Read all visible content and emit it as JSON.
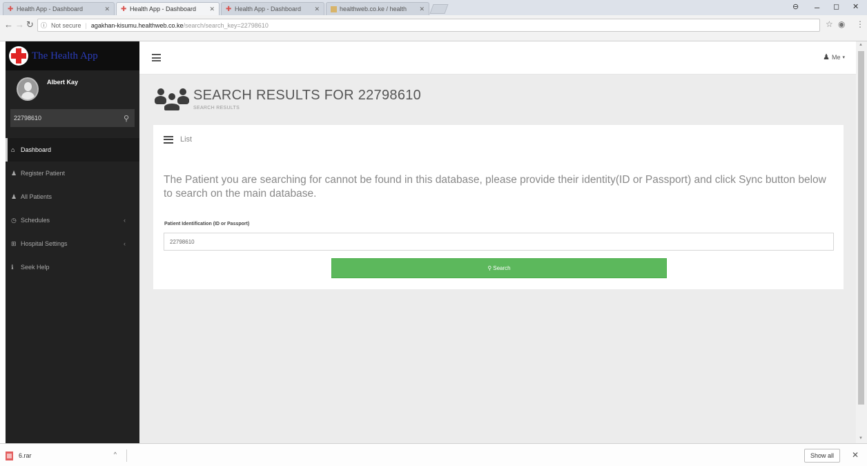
{
  "browser": {
    "tabs": [
      {
        "title": "Health App - Dashboard",
        "active": false,
        "icon": "health-cross-icon"
      },
      {
        "title": "Health App - Dashboard",
        "active": true,
        "icon": "health-cross-icon"
      },
      {
        "title": "Health App - Dashboard",
        "active": false,
        "icon": "health-cross-icon"
      },
      {
        "title": "healthweb.co.ke / health",
        "active": false,
        "icon": "image-icon"
      }
    ],
    "security_label": "Not secure",
    "url_host": "agakhan-kisumu.healthweb.co.ke",
    "url_path": "/search/search_key=22798610"
  },
  "sidebar": {
    "brand_name": "The Health App",
    "user_name": "Albert Kay",
    "search_value": "22798610",
    "menu": [
      {
        "label": "Dashboard",
        "icon": "home-icon",
        "glyph": "⌂",
        "active": true,
        "has_submenu": false
      },
      {
        "label": "Register Patient",
        "icon": "user-icon",
        "glyph": "♟",
        "active": false,
        "has_submenu": false
      },
      {
        "label": "All Patients",
        "icon": "users-icon",
        "glyph": "♟",
        "active": false,
        "has_submenu": false
      },
      {
        "label": "Schedules",
        "icon": "clock-icon",
        "glyph": "◷",
        "active": false,
        "has_submenu": true
      },
      {
        "label": "Hospital Settings",
        "icon": "hospital-icon",
        "glyph": "⊞",
        "active": false,
        "has_submenu": true
      },
      {
        "label": "Seek Help",
        "icon": "info-icon",
        "glyph": "ℹ",
        "active": false,
        "has_submenu": false
      }
    ]
  },
  "topbar": {
    "user_menu_label": "Me"
  },
  "page": {
    "title": "SEARCH RESULTS FOR 22798610",
    "subtitle": "SEARCH RESULTS",
    "panel_title": "List",
    "message": "The Patient you are searching for cannot be found in this database, please provide their identity(ID or Passport) and click Sync button below to search on the main database.",
    "field_label": "Patient Identification (ID or Passport)",
    "field_value": "22798610",
    "search_button_label": "Search"
  },
  "downloads": {
    "file_name": "6.rar",
    "show_all_label": "Show all"
  },
  "colors": {
    "sidebar_bg": "#222222",
    "brand_bg": "#0e0e0e",
    "brand_text": "#2b3dbb",
    "logo_cross": "#e02424",
    "content_bg": "#ececec",
    "button_green": "#5cb85c"
  }
}
